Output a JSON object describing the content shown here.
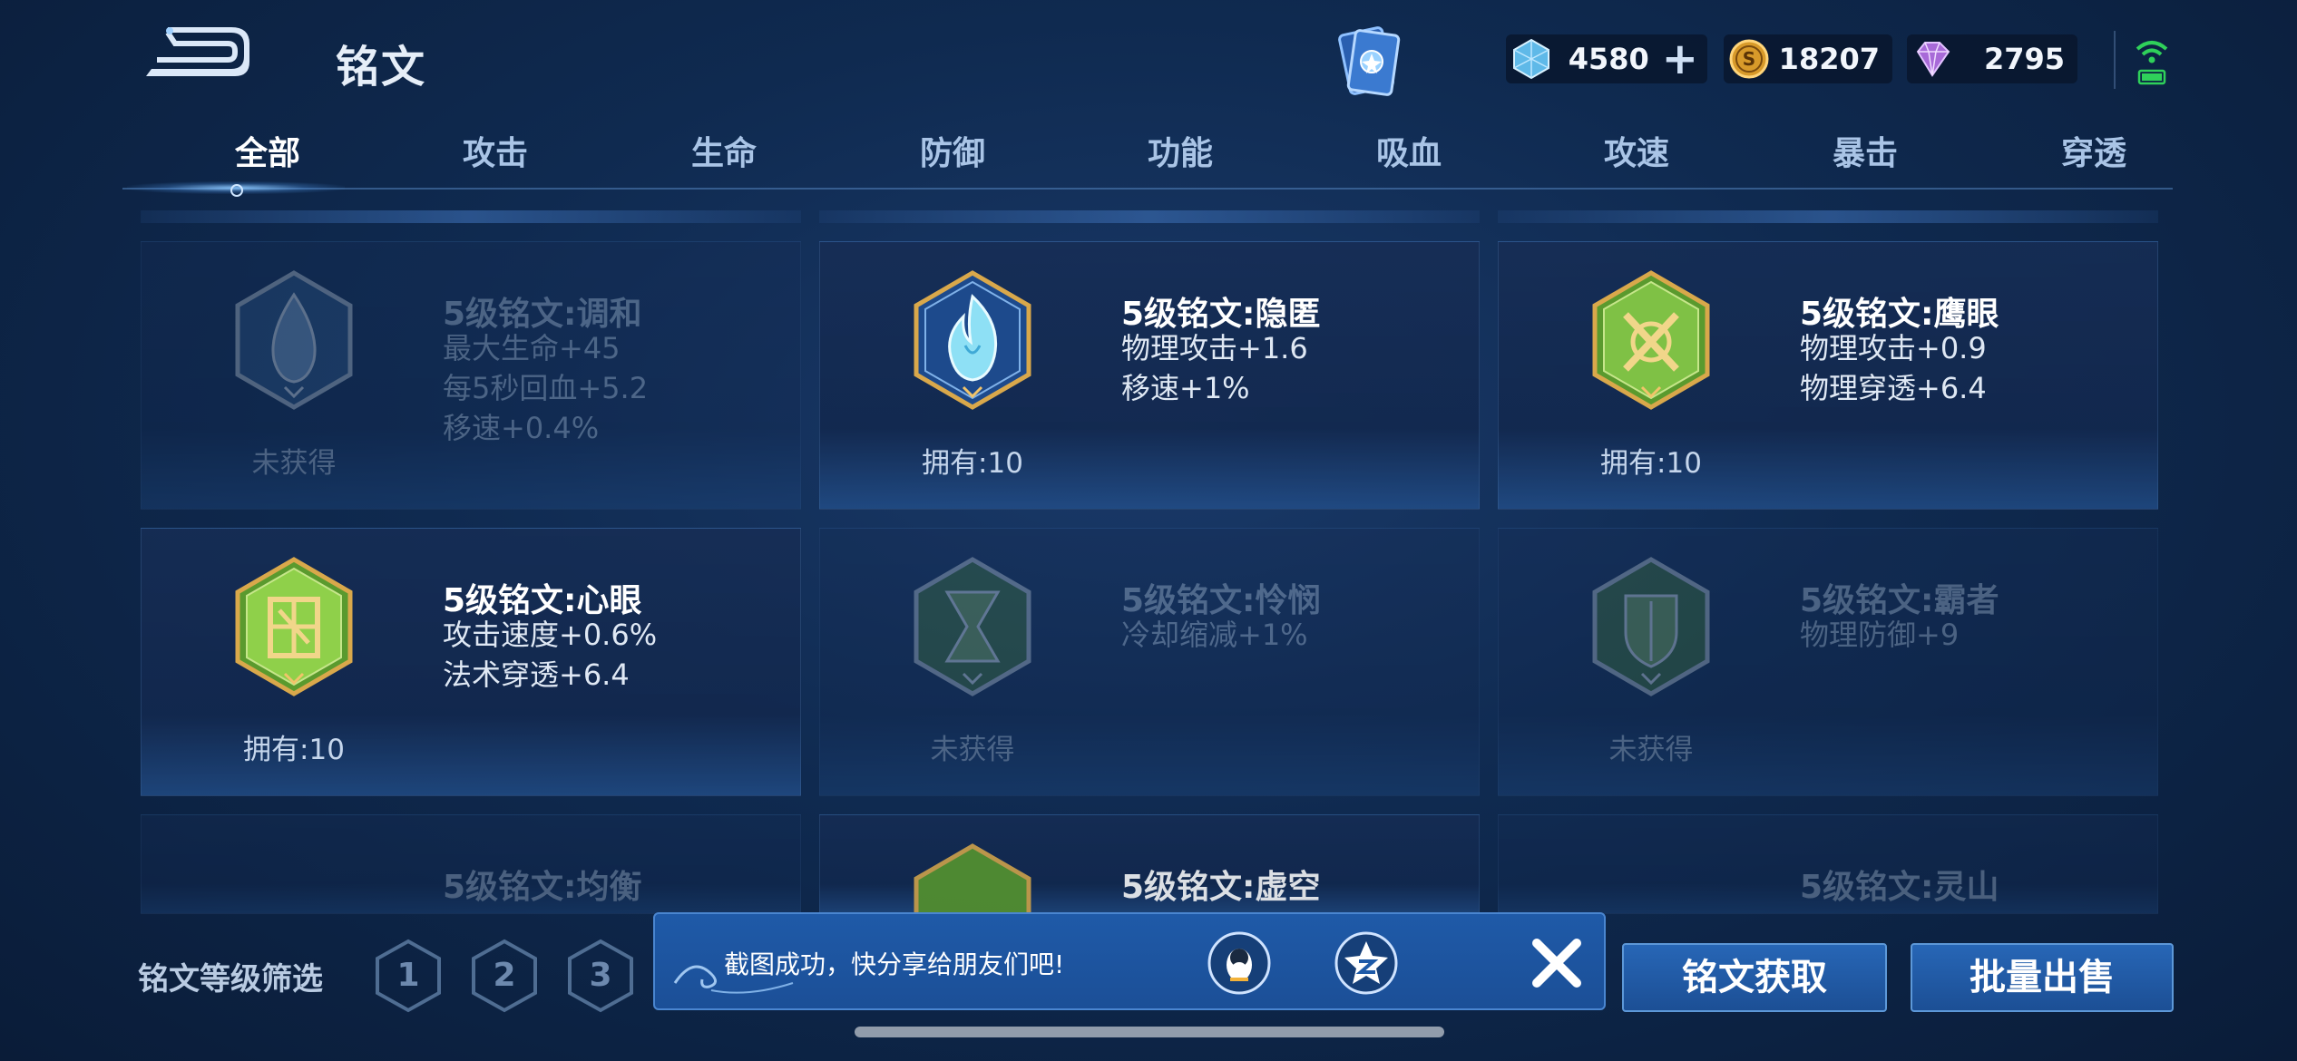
{
  "header": {
    "title": "铭文",
    "back_icon": "back-arrow-icon",
    "deck_icon": "inscription-deck-icon"
  },
  "currencies": [
    {
      "name": "crystal",
      "icon": "crystal-icon",
      "value": "4580",
      "has_add": true,
      "add_label": "+"
    },
    {
      "name": "gold",
      "icon": "gold-coin-icon",
      "value": "18207"
    },
    {
      "name": "gem",
      "icon": "purple-gem-icon",
      "value": "2795"
    }
  ],
  "status": {
    "signal_icon": "wifi-signal-icon",
    "battery_color": "#2fd15a"
  },
  "tabs": [
    {
      "label": "全部",
      "active": true
    },
    {
      "label": "攻击"
    },
    {
      "label": "生命"
    },
    {
      "label": "防御"
    },
    {
      "label": "功能"
    },
    {
      "label": "吸血"
    },
    {
      "label": "攻速"
    },
    {
      "label": "暴击"
    },
    {
      "label": "穿透"
    }
  ],
  "inscriptions": [
    {
      "name": "5级铭文:调和",
      "stats": [
        "最大生命+45",
        "每5秒回血+5.2",
        "移速+0.4%"
      ],
      "owned": "未获得",
      "obtained": false,
      "color": "blue",
      "emblem": "teardrop-emblem-icon"
    },
    {
      "name": "5级铭文:隐匿",
      "stats": [
        "物理攻击+1.6",
        "移速+1%"
      ],
      "owned": "拥有:10",
      "obtained": true,
      "color": "blue",
      "emblem": "flame-emblem-icon"
    },
    {
      "name": "5级铭文:鹰眼",
      "stats": [
        "物理攻击+0.9",
        "物理穿透+6.4"
      ],
      "owned": "拥有:10",
      "obtained": true,
      "color": "green",
      "emblem": "crossed-swords-emblem-icon"
    },
    {
      "name": "5级铭文:心眼",
      "stats": [
        "攻击速度+0.6%",
        "法术穿透+6.4"
      ],
      "owned": "拥有:10",
      "obtained": true,
      "color": "green",
      "emblem": "rune-emblem-icon"
    },
    {
      "name": "5级铭文:怜悯",
      "stats": [
        "冷却缩减+1%"
      ],
      "owned": "未获得",
      "obtained": false,
      "color": "green",
      "emblem": "hourglass-emblem-icon"
    },
    {
      "name": "5级铭文:霸者",
      "stats": [
        "物理防御+9"
      ],
      "owned": "未获得",
      "obtained": false,
      "color": "green",
      "emblem": "shield-emblem-icon"
    },
    {
      "name": "5级铭文:均衡",
      "stats": [],
      "owned": "",
      "obtained": false,
      "color": "green",
      "emblem": "balance-emblem-icon"
    },
    {
      "name": "5级铭文:虚空",
      "stats": [],
      "owned": "",
      "obtained": true,
      "color": "green",
      "emblem": "void-emblem-icon"
    },
    {
      "name": "5级铭文:灵山",
      "stats": [],
      "owned": "",
      "obtained": false,
      "color": "green",
      "emblem": "mountain-emblem-icon"
    }
  ],
  "filter": {
    "label": "铭文等级筛选",
    "levels": [
      "1",
      "2",
      "3"
    ]
  },
  "toast": {
    "message": "截图成功，快分享给朋友们吧!",
    "qq_icon": "qq-penguin-icon",
    "qzone_icon": "qzone-star-icon",
    "close_icon": "close-icon"
  },
  "actions": {
    "acquire": "铭文获取",
    "bulk_sell": "批量出售"
  }
}
